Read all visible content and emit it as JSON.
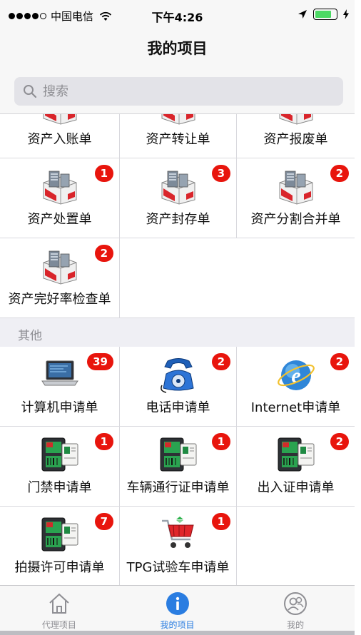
{
  "status_bar": {
    "carrier": "中国电信",
    "time": "下午4:26",
    "battery_level": 0.8
  },
  "nav": {
    "title": "我的项目"
  },
  "search": {
    "placeholder": "搜索"
  },
  "colors": {
    "accent": "#2a7de1",
    "badge": "#e8150d",
    "battery": "#4cd964"
  },
  "asset_items": [
    {
      "label": "资产入账单",
      "icon": "asset-factory-icon",
      "badge": ""
    },
    {
      "label": "资产转让单",
      "icon": "asset-factory-icon",
      "badge": ""
    },
    {
      "label": "资产报废单",
      "icon": "asset-factory-icon",
      "badge": ""
    },
    {
      "label": "资产处置单",
      "icon": "asset-factory-icon",
      "badge": "1"
    },
    {
      "label": "资产封存单",
      "icon": "asset-factory-icon",
      "badge": "3"
    },
    {
      "label": "资产分割合并单",
      "icon": "asset-factory-icon",
      "badge": "2"
    },
    {
      "label": "资产完好率检查单",
      "icon": "asset-factory-icon",
      "badge": "2"
    }
  ],
  "other_section": {
    "title": "其他"
  },
  "other_items": [
    {
      "label": "计算机申请单",
      "icon": "laptop-icon",
      "badge": "39"
    },
    {
      "label": "电话申请单",
      "icon": "telephone-icon",
      "badge": "2"
    },
    {
      "label": "Internet申请单",
      "icon": "internet-explorer-icon",
      "badge": "2"
    },
    {
      "label": "门禁申请单",
      "icon": "id-card-icon",
      "badge": "1"
    },
    {
      "label": "车辆通行证申请单",
      "icon": "id-card-icon",
      "badge": "1"
    },
    {
      "label": "出入证申请单",
      "icon": "id-card-icon",
      "badge": "2"
    },
    {
      "label": "拍摄许可申请单",
      "icon": "id-card-icon",
      "badge": "7"
    },
    {
      "label": "TPG试验车申请单",
      "icon": "shopping-cart-icon",
      "badge": "1"
    }
  ],
  "tab_bar": {
    "tabs": [
      {
        "label": "代理项目",
        "icon": "home-icon",
        "active": false
      },
      {
        "label": "我的项目",
        "icon": "info-icon",
        "active": true
      },
      {
        "label": "我的",
        "icon": "user-icon",
        "active": false
      }
    ]
  }
}
